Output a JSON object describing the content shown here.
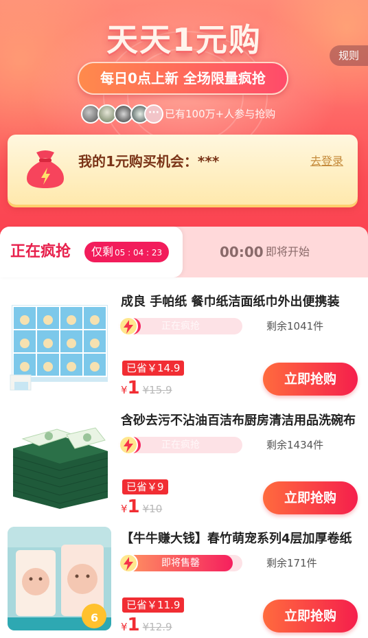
{
  "hero": {
    "title": "天天1元购",
    "rules_label": "规则",
    "slogan": "每日0点上新 全场限量疯抢",
    "avatar_more": "···",
    "participants_text": "已有100万+人参与抢购"
  },
  "login_card": {
    "chance_label": "我的1元购买机会：***",
    "login_link": "去登录"
  },
  "tabs": {
    "active": {
      "label": "正在疯抢",
      "countdown_prefix": "仅剩",
      "countdown_time": "05 : 04 : 23"
    },
    "upcoming": {
      "time": "00:00",
      "label": "即将开始"
    }
  },
  "products": [
    {
      "title": "成良 手帕纸 餐巾纸洁面纸巾外出便携装",
      "status": "正在疯抢",
      "progress": 0.18,
      "stock": "剩余1041件",
      "save": "已省￥14.9",
      "currency": "¥",
      "price": "1",
      "original_price": "¥15.9",
      "buy_label": "立即抢购"
    },
    {
      "title": "含砂去污不沾油百洁布厨房清洁用品洗碗布",
      "status": "正在疯抢",
      "progress": 0.18,
      "stock": "剩余1434件",
      "save": "已省￥9",
      "currency": "¥",
      "price": "1",
      "original_price": "¥10",
      "buy_label": "立即抢购"
    },
    {
      "title": "【牛牛赚大钱】春竹萌宠系列4层加厚卷纸",
      "status": "即将售罄",
      "progress": 0.92,
      "stock": "剩余171件",
      "save": "已省￥11.9",
      "currency": "¥",
      "price": "1",
      "original_price": "¥12.9",
      "buy_label": "立即抢购"
    }
  ],
  "colors": {
    "brand_red": "#f12d33",
    "accent_pink": "#f21c5b",
    "button_gradient_start": "#ff6b3e",
    "button_gradient_end": "#f51f4c"
  }
}
